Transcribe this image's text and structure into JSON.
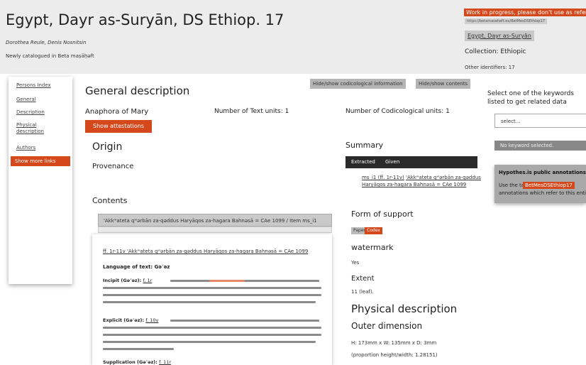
{
  "header": {
    "title": "Egypt, Dayr as-Suryān, DS Ethiop. 17",
    "authors": "Dorothea Reule, Denis Nosnitsin",
    "newly": "Newly catalogued in Beta maṣāḥǝft",
    "wip_notice": "Work in progress, please don't use as reference",
    "uri": "https://betamasaheft.eu/BetMesDSEthiop17",
    "repository_link": "Egypt, Dayr as-Suryān",
    "collection": "Collection: Ethiopic",
    "other_identifiers": "Other identifiers: 17"
  },
  "sidebar": {
    "items": [
      "Persons Index",
      "General",
      "Description",
      "Physical description",
      "Authors"
    ],
    "show_more": "Show more links"
  },
  "toolbar": {
    "hide_codico": "Hide/show codicological information",
    "hide_contents": "Hide/show contents"
  },
  "main": {
    "general_description": "General description",
    "anaphora": "Anaphora of Mary",
    "text_units": "Number of Text units: 1",
    "codico_units": "Number of Codicological units: 1",
    "show_attestations": "Show attestations",
    "origin": "Origin",
    "provenance": "Provenance",
    "contents": "Contents",
    "item_title": "'Akkʷateta qʷərbān za-qəddus Haryāqos za-hagara Bahnəsā = CAe 1099 / Item ms_i1",
    "ref_line": "ff. 1r-11v 'Akkʷateta qʷərbān za-qəddus Haryāqos za-hagara Bahnəsā = CAe 1099",
    "language": "Language of text: Gəʿəz",
    "incipit": "Incipit (Gəʿəz):",
    "incipit_ref": "f. 1r",
    "explicit": "Explicit (Gəʿəz):",
    "explicit_ref": "f. 10v",
    "supplication": "Supplication (Gəʿəz):",
    "supplication_ref": "f. 11r"
  },
  "summary": {
    "heading": "Summary",
    "tab_extracted": "Extracted",
    "tab_given": "Given",
    "entry_ref": "ms_i1 (ff. 1r-11v)",
    "entry_text": "'Akkʷateta qʷərbān za-qəddus Haryāqos za-hagara Bahnəsā = CAe 1099",
    "form_of_support": "Form of support",
    "badge_paper": "Paper",
    "badge_codex": "Codex",
    "watermark": "watermark",
    "watermark_value": "Yes",
    "extent": "Extent",
    "extent_value": "11 (leaf).",
    "physical_description": "Physical description",
    "outer_dimension": "Outer dimension",
    "dimensions": "H: 173mm x W: 135mm x D: 3mm",
    "proportion": "(proportion height/width: 1.28151)"
  },
  "keywords": {
    "prompt": "Select one of the keywords listed to get related data",
    "select_placeholder": "select...",
    "none_selected": "No keyword selected."
  },
  "hypothesis": {
    "title": "Hypothes.is public annotations pages",
    "text_before": "Use the tag",
    "tag": "BetMesDSEthiop17",
    "text_after": "annotations which refer to this entity."
  },
  "colors": {
    "accent": "#d4481c",
    "header_bg": "#ececec",
    "dark_tab": "#2a2a2a"
  }
}
